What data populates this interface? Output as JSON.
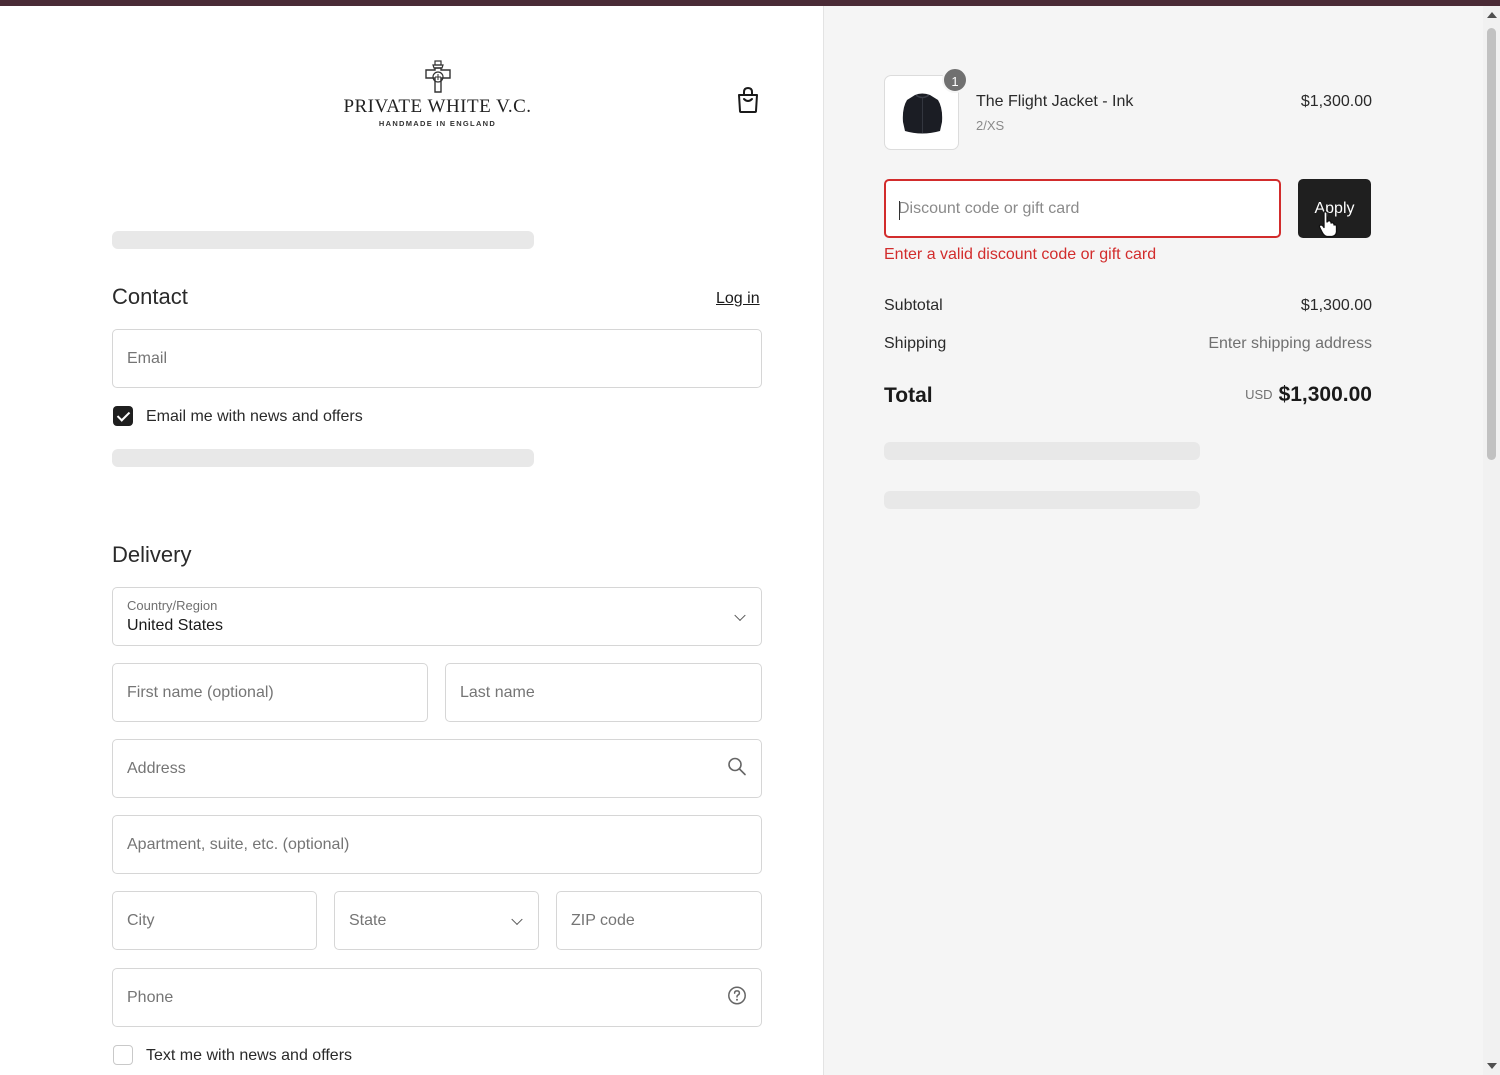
{
  "brand": {
    "name": "PRIVATE WHITE V.C.",
    "tagline": "HANDMADE IN ENGLAND"
  },
  "contact": {
    "title": "Contact",
    "login_label": "Log in",
    "email_placeholder": "Email",
    "newsletter_label": "Email me with news and offers",
    "newsletter_checked": true
  },
  "delivery": {
    "title": "Delivery",
    "country_label": "Country/Region",
    "country_value": "United States",
    "first_name_placeholder": "First name (optional)",
    "last_name_placeholder": "Last name",
    "address_placeholder": "Address",
    "apartment_placeholder": "Apartment, suite, etc. (optional)",
    "city_placeholder": "City",
    "state_placeholder": "State",
    "zip_placeholder": "ZIP code",
    "phone_placeholder": "Phone",
    "sms_label": "Text me with news and offers",
    "sms_checked": false
  },
  "cart": {
    "item": {
      "quantity": "1",
      "name": "The Flight Jacket - Ink",
      "variant": "2/XS",
      "price": "$1,300.00"
    },
    "discount_placeholder": "Discount code or gift card",
    "apply_label": "Apply",
    "discount_error": "Enter a valid discount code or gift card",
    "subtotal_label": "Subtotal",
    "subtotal_value": "$1,300.00",
    "shipping_label": "Shipping",
    "shipping_value": "Enter shipping address",
    "total_label": "Total",
    "currency": "USD",
    "total_value": "$1,300.00"
  },
  "colors": {
    "topbar": "#4a2b36",
    "error": "#d22c2c",
    "button": "#1f1f1f"
  }
}
